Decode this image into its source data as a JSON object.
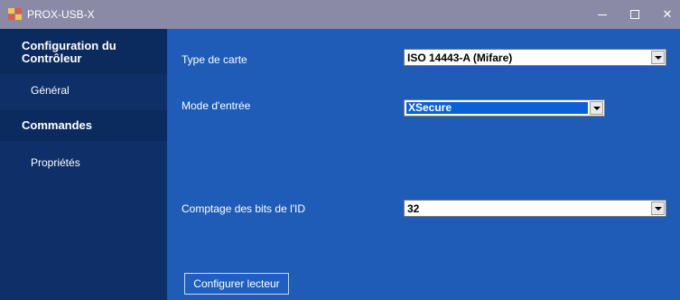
{
  "window": {
    "title": "PROX-USB-X",
    "icon": "app-grid-icon",
    "controls": {
      "minimize": "─",
      "maximize": "☐",
      "close": "✕"
    }
  },
  "sidebar": {
    "section1": "Configuration du Contrôleur",
    "item1": "Général",
    "section2": "Commandes",
    "item2": "Propriétés"
  },
  "form": {
    "card_type_label": "Type de carte",
    "card_type_value": "ISO 14443-A (Mifare)",
    "input_mode_label": "Mode d'entrée",
    "input_mode_value": "XSecure",
    "bit_count_label": "Comptage des bits de l'ID",
    "bit_count_value": "32",
    "configure_button": "Configurer lecteur"
  },
  "colors": {
    "titlebar": "#8a8aa6",
    "sidebar": "#0e2f68",
    "main": "#1e5cb8",
    "selection": "#0a61d6"
  }
}
